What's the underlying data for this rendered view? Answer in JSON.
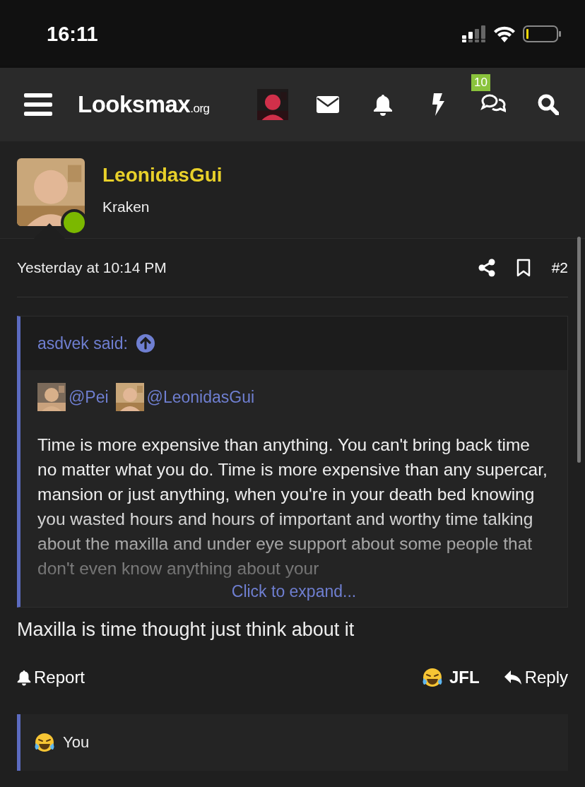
{
  "status_bar": {
    "time": "16:11"
  },
  "nav": {
    "logo": "Looksmax",
    "logo_suffix": ".org",
    "conversations_badge": "10"
  },
  "post": {
    "author": "LeonidasGui",
    "user_title": "Kraken",
    "online": true,
    "date": "Yesterday at 10:14 PM",
    "number": "#2",
    "quote": {
      "attribution": "asdvek said:",
      "mentions": [
        "@Pei",
        "@LeonidasGui"
      ],
      "text": "Time is more expensive than anything. You can't bring back time no matter what you do. Time is more expensive than any supercar, mansion or just anything, when you're in your death bed knowing you wasted hours and hours of important and worthy time talking about the maxilla and under eye support about some people that don't even know anything about your",
      "expand_label": "Click to expand..."
    },
    "message": "Maxilla is time thought just think about it",
    "actions": {
      "report": "Report",
      "reaction": "JFL",
      "reply": "Reply"
    },
    "reactions_bar": {
      "label": "You"
    }
  }
}
